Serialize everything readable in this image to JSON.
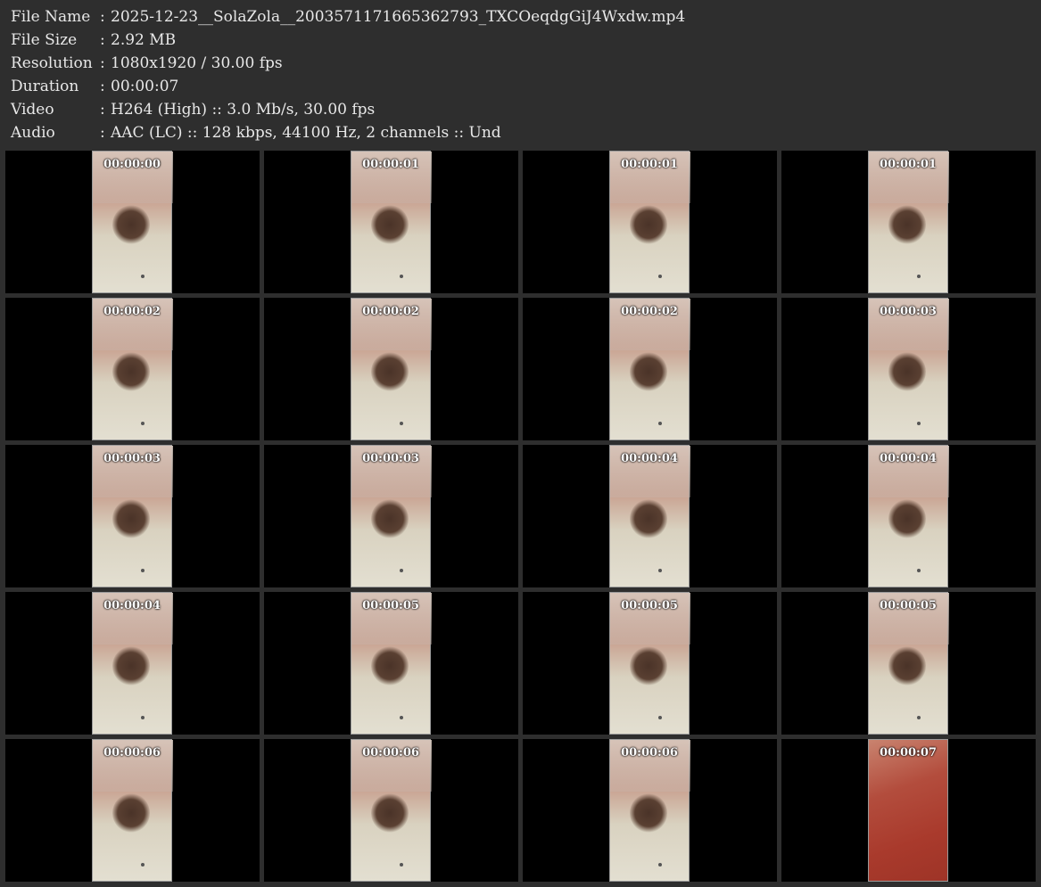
{
  "info": {
    "file_name_label": "File Name",
    "file_name_value": "2025-12-23__SolaZola__2003571171665362793_TXCOeqdgGiJ4Wxdw.mp4",
    "file_size_label": "File Size",
    "file_size_value": "2.92 MB",
    "resolution_label": "Resolution",
    "resolution_value": "1080x1920 / 30.00 fps",
    "duration_label": "Duration",
    "duration_value": "00:00:07",
    "video_label": "Video",
    "video_value": "H264 (High) :: 3.0 Mb/s, 30.00 fps",
    "audio_label": "Audio",
    "audio_value": "AAC (LC) :: 128 kbps, 44100 Hz, 2 channels :: Und",
    "separator": ":"
  },
  "thumbnails": [
    "00:00:00",
    "00:00:01",
    "00:00:01",
    "00:00:01",
    "00:00:02",
    "00:00:02",
    "00:00:02",
    "00:00:03",
    "00:00:03",
    "00:00:03",
    "00:00:04",
    "00:00:04",
    "00:00:04",
    "00:00:05",
    "00:00:05",
    "00:00:05",
    "00:00:06",
    "00:00:06",
    "00:00:06",
    "00:00:07"
  ]
}
